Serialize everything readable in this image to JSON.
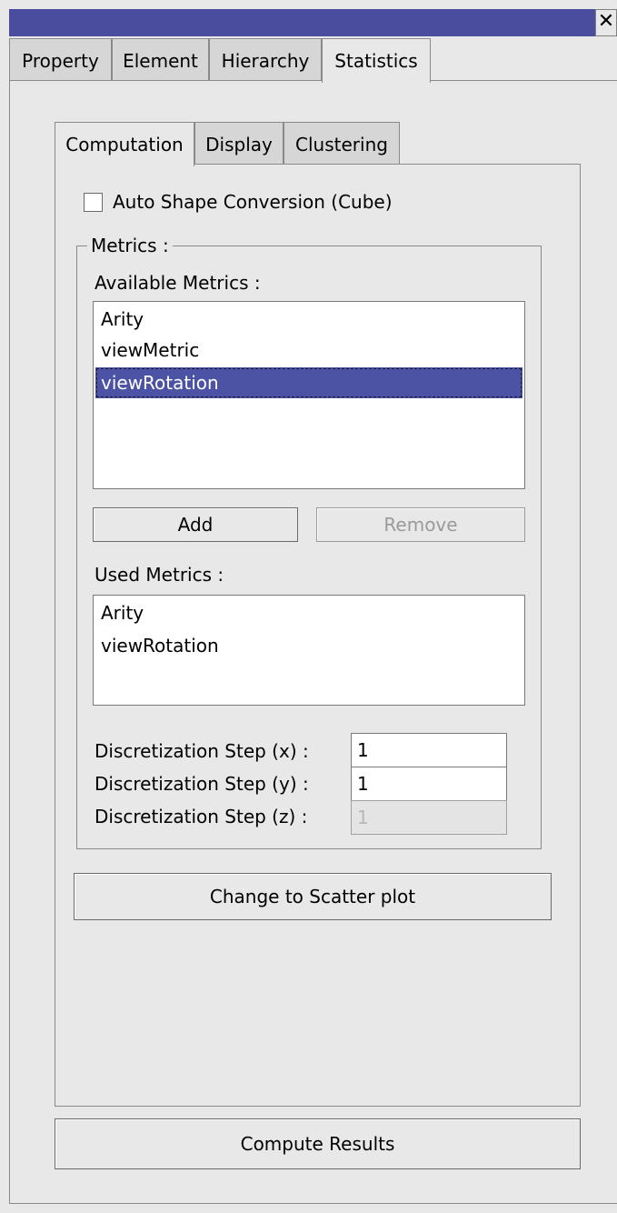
{
  "window": {
    "close_glyph": "✕"
  },
  "outer_tabs": [
    "Property",
    "Element",
    "Hierarchy",
    "Statistics"
  ],
  "inner_tabs": [
    "Computation",
    "Display",
    "Clustering"
  ],
  "computation": {
    "auto_shape_label": "Auto Shape Conversion (Cube)",
    "auto_shape_checked": false,
    "metrics_group_label": "Metrics :",
    "available_label": "Available Metrics :",
    "available_items": [
      "Arity",
      "viewMetric",
      "viewRotation"
    ],
    "available_selected": "viewRotation",
    "add_label": "Add",
    "remove_label": "Remove",
    "used_label": "Used Metrics :",
    "used_items": [
      "Arity",
      "viewRotation"
    ],
    "step_x_label": "Discretization Step (x) :",
    "step_y_label": "Discretization Step (y) :",
    "step_z_label": "Discretization Step (z) :",
    "step_x_value": "1",
    "step_y_value": "1",
    "step_z_value": "1",
    "scatter_label": "Change to Scatter plot"
  },
  "compute_label": "Compute Results",
  "colors": {
    "titlebar": "#4a4c9e",
    "selection": "#4c53a4",
    "panel": "#e8e8e8"
  }
}
